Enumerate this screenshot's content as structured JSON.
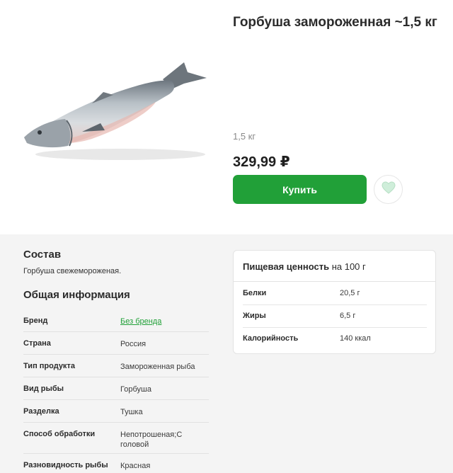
{
  "product": {
    "title": "Горбуша замороженная ~1,5 кг",
    "weight": "1,5 кг",
    "price": "329,99 ₽",
    "buy_label": "Купить",
    "image_icon": "frozen-fish-image",
    "favorite_icon": "heart-icon"
  },
  "composition": {
    "title": "Состав",
    "text": "Горбуша свежемороженая."
  },
  "general_info": {
    "title": "Общая информация",
    "rows": [
      {
        "key": "Бренд",
        "value": "Без бренда"
      },
      {
        "key": "Страна",
        "value": "Россия"
      },
      {
        "key": "Тип продукта",
        "value": "Замороженная рыба"
      },
      {
        "key": "Вид рыбы",
        "value": "Горбуша"
      },
      {
        "key": "Разделка",
        "value": "Тушка"
      },
      {
        "key": "Способ обработки",
        "value": "Непотрошеная;С головой"
      },
      {
        "key": "Разновидность рыбы",
        "value": "Красная"
      }
    ]
  },
  "nutrition": {
    "title_bold": "Пищевая ценность",
    "title_rest": "на 100 г",
    "rows": [
      {
        "key": "Белки",
        "value": "20,5 г"
      },
      {
        "key": "Жиры",
        "value": "6,5 г"
      },
      {
        "key": "Калорийность",
        "value": "140 ккал"
      }
    ]
  },
  "colors": {
    "accent": "#21a038",
    "background_info": "#f4f4f4"
  }
}
